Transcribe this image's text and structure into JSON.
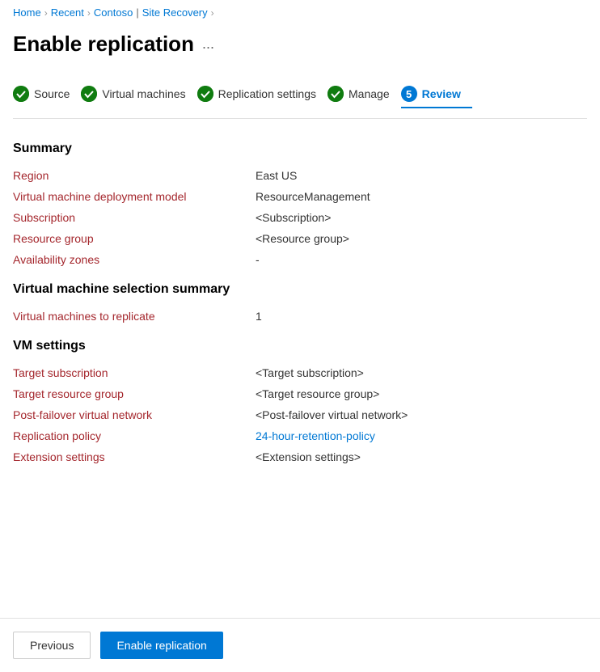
{
  "breadcrumb": {
    "home": "Home",
    "recent": "Recent",
    "contoso": "Contoso",
    "separator": "|",
    "site_recovery": "Site Recovery"
  },
  "page": {
    "title": "Enable replication",
    "more_icon": "..."
  },
  "steps": [
    {
      "id": "source",
      "label": "Source",
      "state": "completed",
      "number": ""
    },
    {
      "id": "virtual-machines",
      "label": "Virtual machines",
      "state": "completed",
      "number": ""
    },
    {
      "id": "replication-settings",
      "label": "Replication settings",
      "state": "completed",
      "number": ""
    },
    {
      "id": "manage",
      "label": "Manage",
      "state": "completed",
      "number": ""
    },
    {
      "id": "review",
      "label": "Review",
      "state": "current",
      "number": "5"
    }
  ],
  "summary": {
    "heading": "Summary",
    "rows": [
      {
        "label": "Region",
        "value": "East US",
        "link": false
      },
      {
        "label": "Virtual machine deployment model",
        "value": "ResourceManagement",
        "link": false
      },
      {
        "label": "Subscription",
        "value": "<Subscription>",
        "link": false
      },
      {
        "label": "Resource group",
        "value": "<Resource group>",
        "link": false
      },
      {
        "label": "Availability zones",
        "value": "-",
        "link": false
      }
    ]
  },
  "vm_selection": {
    "heading": "Virtual machine selection summary",
    "rows": [
      {
        "label": "Virtual machines to replicate",
        "value": "1",
        "link": false
      }
    ]
  },
  "vm_settings": {
    "heading": "VM settings",
    "rows": [
      {
        "label": "Target subscription",
        "value": "<Target subscription>",
        "link": false
      },
      {
        "label": "Target resource group",
        "value": "<Target resource group>",
        "link": false
      },
      {
        "label": "Post-failover virtual network",
        "value": "<Post-failover virtual network>",
        "link": false
      },
      {
        "label": "Replication policy",
        "value": "24-hour-retention-policy",
        "link": true
      },
      {
        "label": "Extension settings",
        "value": "<Extension settings>",
        "link": false
      }
    ]
  },
  "actions": {
    "previous_label": "Previous",
    "enable_label": "Enable replication"
  }
}
